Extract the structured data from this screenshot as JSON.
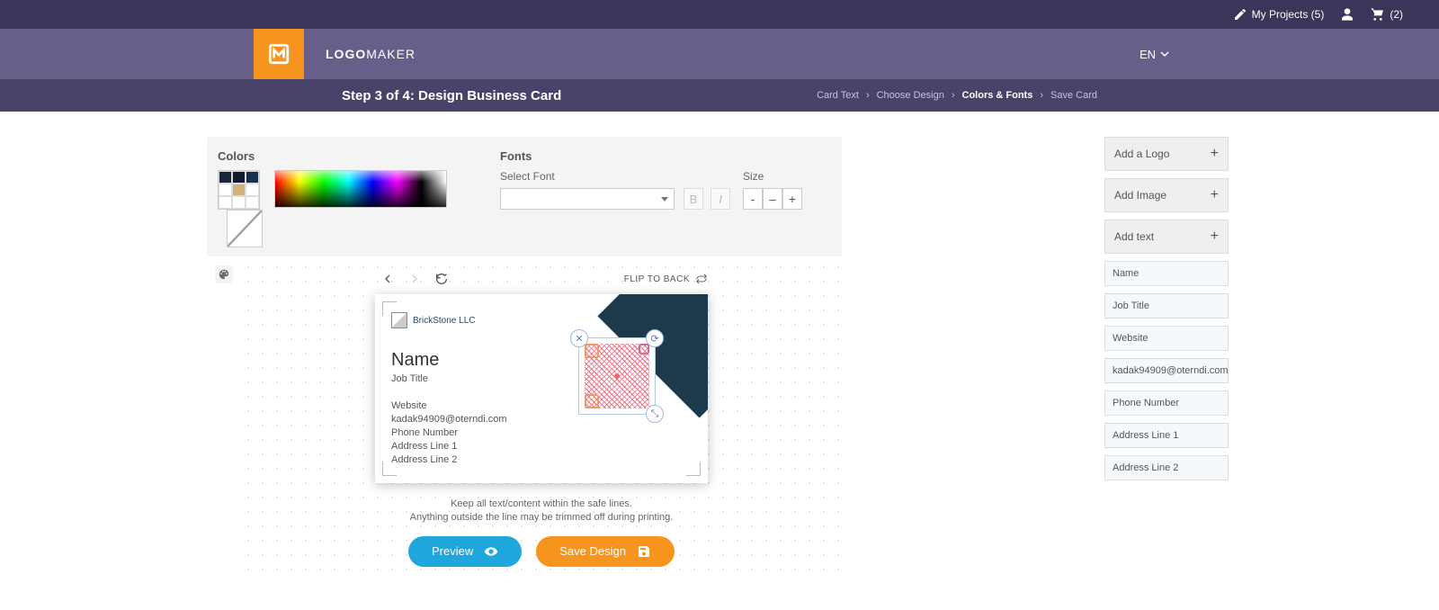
{
  "topbar": {
    "projects": "My Projects (5)",
    "cart": "(2)"
  },
  "brand": {
    "name_a": "LOGO",
    "name_b": "MAKER"
  },
  "lang": "EN",
  "step_title": "Step 3 of 4: Design Business Card",
  "crumbs": [
    "Card Text",
    "Choose Design",
    "Colors & Fonts",
    "Save Card"
  ],
  "crumb_active_index": 2,
  "colors": {
    "title": "Colors",
    "swatches": [
      "#1a2537",
      "#0e1a2f",
      "#17314d",
      "#fff",
      "#d2b17a",
      "#fff",
      "#fff",
      "#fff",
      "#fff"
    ]
  },
  "fonts": {
    "title": "Fonts",
    "select_label": "Select Font",
    "size_label": "Size"
  },
  "canvas": {
    "flip": "FLIP TO BACK",
    "company": "BrickStone LLC",
    "name": "Name",
    "job": "Job Title",
    "fields": [
      "Website",
      "kadak94909@oterndi.com",
      "Phone Number",
      "Address Line 1",
      "Address Line 2"
    ],
    "note1": "Keep all text/content within the safe lines.",
    "note2": "Anything outside the line may be trimmed off during printing."
  },
  "actions": {
    "preview": "Preview",
    "save": "Save Design"
  },
  "side": {
    "headers": [
      "Add a Logo",
      "Add Image",
      "Add text"
    ],
    "inputs": [
      "Name",
      "Job Title",
      "Website",
      "kadak94909@oterndi.com",
      "Phone Number",
      "Address Line 1",
      "Address Line 2"
    ]
  }
}
